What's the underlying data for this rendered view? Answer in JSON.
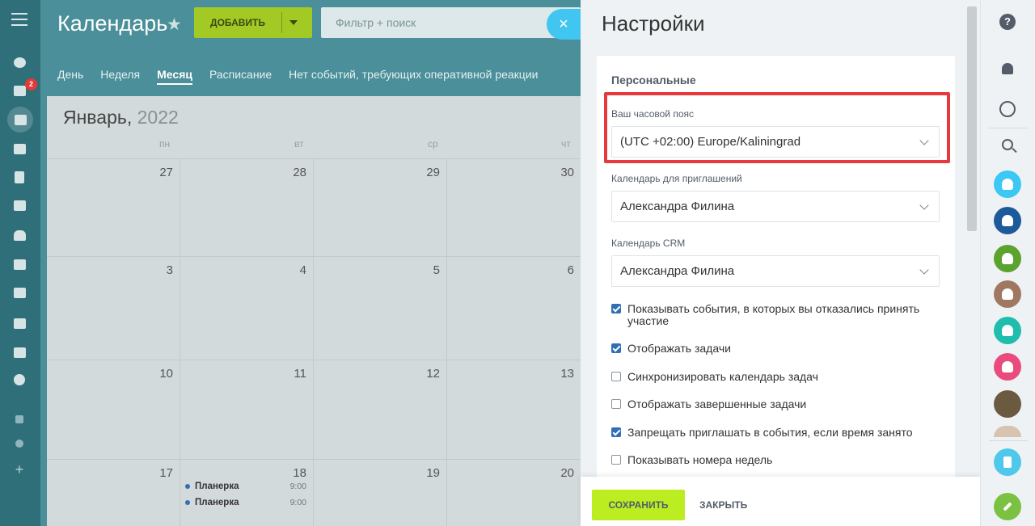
{
  "app": {
    "title": "Календарь",
    "add_label": "ДОБАВИТЬ",
    "search_placeholder": "Фильтр + поиск",
    "close_icon": "×",
    "notification_badge": "2"
  },
  "view_tabs": [
    "День",
    "Неделя",
    "Месяц",
    "Расписание",
    "Нет событий, требующих оперативной реакции"
  ],
  "active_view": "Месяц",
  "calendar": {
    "month": "Январь,",
    "year": "2022",
    "weekdays": [
      "пн",
      "вт",
      "ср",
      "чт"
    ],
    "weeks": [
      [
        "27",
        "28",
        "29",
        "30"
      ],
      [
        "3",
        "4",
        "5",
        "6"
      ],
      [
        "10",
        "11",
        "12",
        "13"
      ],
      [
        "17",
        "18",
        "19",
        "20"
      ]
    ],
    "events": [
      {
        "title": "Планерка",
        "time": "9:00"
      },
      {
        "title": "Планерка",
        "time": "9:00"
      }
    ]
  },
  "settings": {
    "title": "Настройки",
    "section": "Персональные",
    "timezone": {
      "label": "Ваш часовой пояс",
      "value": "(UTC +02:00) Europe/Kaliningrad"
    },
    "invite_calendar": {
      "label": "Календарь для приглашений",
      "value": "Александра Филина"
    },
    "crm_calendar": {
      "label": "Календарь CRM",
      "value": "Александра Филина"
    },
    "checkboxes": [
      {
        "label": "Показывать события, в которых вы отказались принять участие",
        "checked": true
      },
      {
        "label": "Отображать задачи",
        "checked": true
      },
      {
        "label": "Синхронизировать календарь задач",
        "checked": false
      },
      {
        "label": "Отображать завершенные задачи",
        "checked": false
      },
      {
        "label": "Запрещать приглашать в события, если время занято",
        "checked": true
      },
      {
        "label": "Показывать номера недель",
        "checked": false
      }
    ],
    "save_label": "СОХРАНИТЬ",
    "close_label": "ЗАКРЫТЬ"
  },
  "right_rail": {
    "help_icon": "?",
    "avatar_colors": [
      "#3bc8f5",
      "#1d5a99",
      "#5ca22e",
      "#a07862",
      "#1ebdae",
      "#e94c7c",
      "#6b5a40",
      "#d7c3b0",
      "#4fc8ec",
      "#7bc142"
    ]
  },
  "colors": {
    "accent_green": "#bbed21",
    "highlight_red": "#e5393d",
    "checkbox_blue": "#2f6fb5"
  }
}
